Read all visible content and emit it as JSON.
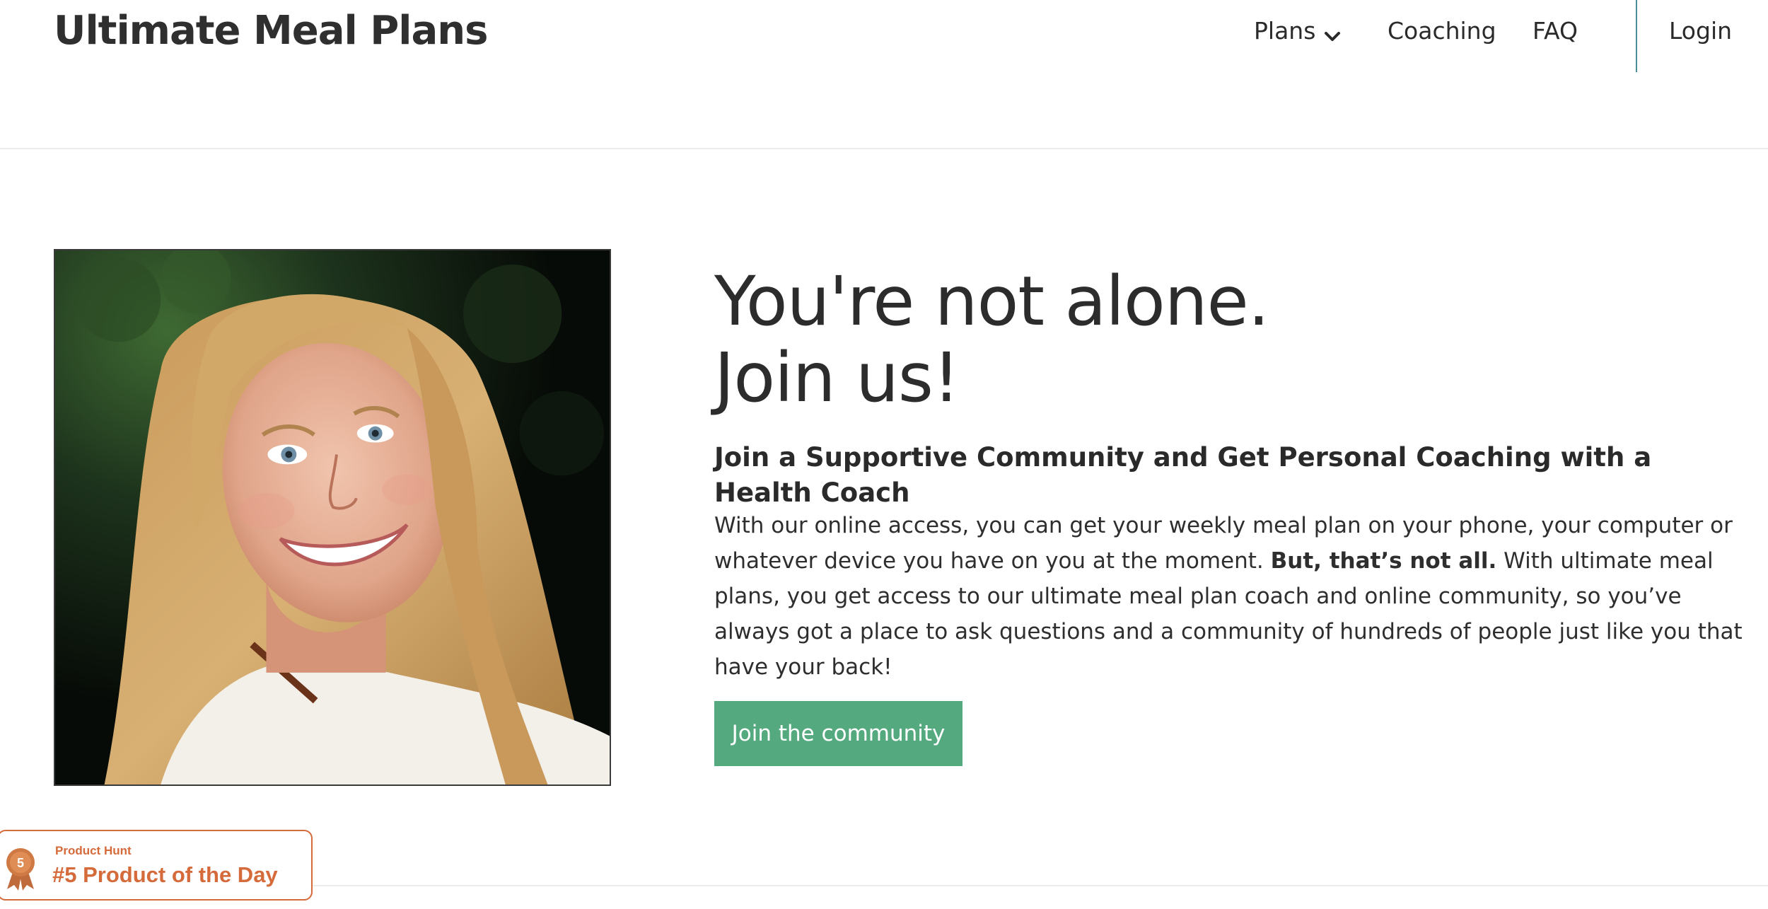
{
  "header": {
    "logo": "Ultimate Meal Plans",
    "nav": {
      "plans": "Plans",
      "coaching": "Coaching",
      "faq": "FAQ",
      "login": "Login"
    }
  },
  "hero": {
    "headline_line1": "You're not alone.",
    "headline_line2": "Join us!",
    "subheading": "Join a Supportive Community and Get Personal Coaching with a Health Coach",
    "body_part1": "With our online access, you can get your weekly meal plan on your phone, your computer or whatever device you have on you at the moment. ",
    "body_bold": "But, that’s not all.",
    "body_part2": " With ultimate meal plans, you get access to our ultimate meal plan coach and online community, so you’ve always got a place to ask questions and a community of hundreds of people just like you that have your back!",
    "cta_label": "Join the community",
    "photo_icon": "smiling-woman-portrait"
  },
  "product_hunt_badge": {
    "small_label": "Product Hunt",
    "big_label": "#5 Product of the Day",
    "medal_number": "5",
    "icon": "medal-icon"
  },
  "colors": {
    "cta": "#55a97f",
    "badge": "#d56a3b",
    "nav_divider": "#4a8e98",
    "text": "#2e2e2e"
  }
}
